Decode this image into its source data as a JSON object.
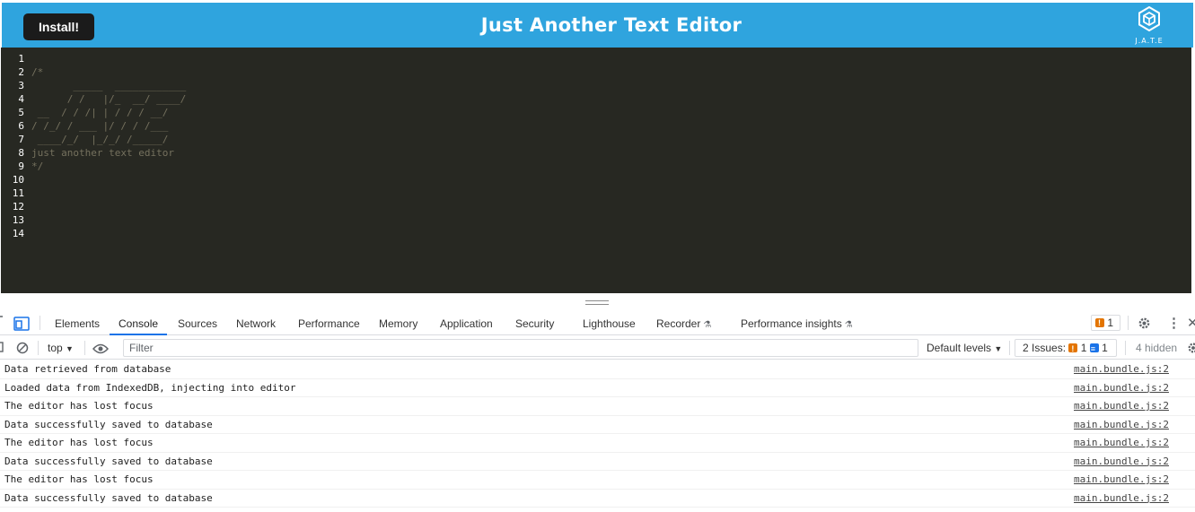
{
  "header": {
    "install_label": "Install!",
    "title": "Just Another Text Editor",
    "logo_icon": "cube-logo-icon",
    "logo_text": "J.A.T.E",
    "bg_color": "#2fa4de"
  },
  "editor": {
    "bg_color": "#272822",
    "line_numbers": [
      "1",
      "2",
      "3",
      "4",
      "5",
      "6",
      "7",
      "8",
      "9",
      "10",
      "11",
      "12",
      "13",
      "14"
    ],
    "lines": [
      "",
      "/*",
      "       _____  ____________",
      "      / /   |/_  __/ ____/",
      " __  / / /| | / / / __/",
      "/ /_/ / ___ |/ / / /___",
      " ____/_/  |_/_/ /_____/",
      "just another text editor",
      "*/",
      "",
      "",
      "",
      "",
      ""
    ]
  },
  "devtools": {
    "tabs": [
      {
        "label": "Elements",
        "active": false
      },
      {
        "label": "Console",
        "active": true
      },
      {
        "label": "Sources",
        "active": false
      },
      {
        "label": "Network",
        "active": false
      },
      {
        "label": "Performance",
        "active": false
      },
      {
        "label": "Memory",
        "active": false
      },
      {
        "label": "Application",
        "active": false
      },
      {
        "label": "Security",
        "active": false
      },
      {
        "label": "Lighthouse",
        "active": false
      },
      {
        "label": "Recorder",
        "active": false
      },
      {
        "label": "Performance insights",
        "active": false
      }
    ],
    "issue_count_badge": "1",
    "toolbar": {
      "context": "top",
      "filter_placeholder": "Filter",
      "levels": "Default levels",
      "issues_label": "2 Issues:",
      "issues_warn": "1",
      "issues_info": "1",
      "hidden": "4 hidden"
    },
    "logs": [
      {
        "message": "Data retrieved from database",
        "source": "main.bundle.js:2"
      },
      {
        "message": "Loaded data from IndexedDB, injecting into editor",
        "source": "main.bundle.js:2"
      },
      {
        "message": "The editor has lost focus",
        "source": "main.bundle.js:2"
      },
      {
        "message": "Data successfully saved to database",
        "source": "main.bundle.js:2"
      },
      {
        "message": "The editor has lost focus",
        "source": "main.bundle.js:2"
      },
      {
        "message": "Data successfully saved to database",
        "source": "main.bundle.js:2"
      },
      {
        "message": "The editor has lost focus",
        "source": "main.bundle.js:2"
      },
      {
        "message": "Data successfully saved to database",
        "source": "main.bundle.js:2"
      }
    ]
  }
}
